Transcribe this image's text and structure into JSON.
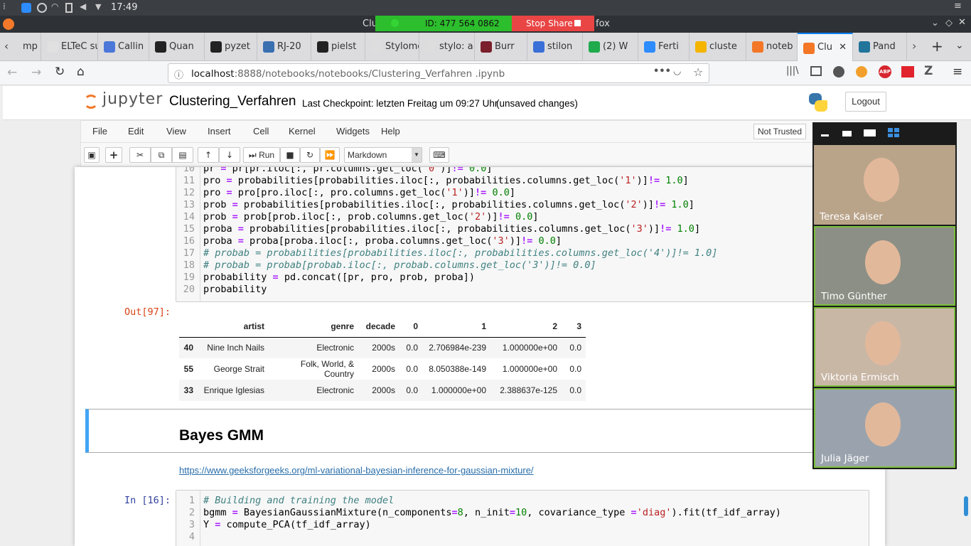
{
  "system": {
    "time": "17:49"
  },
  "share": {
    "meeting_id": "ID: 477 564 0862",
    "stop_label": "Stop Share",
    "title_left": "Clu",
    "title_right": "fox"
  },
  "tabs": [
    {
      "label": "mp",
      "color": "#777"
    },
    {
      "label": "ELTeC su",
      "color": "#e0e0e0"
    },
    {
      "label": "Callin",
      "color": "#4a77d8"
    },
    {
      "label": "Quan",
      "color": "#222"
    },
    {
      "label": "pyzet",
      "color": "#222"
    },
    {
      "label": "RJ-20",
      "color": "#3a6fb0"
    },
    {
      "label": "pielst",
      "color": "#222"
    },
    {
      "label": "Stylomet",
      "color": "#ddd"
    },
    {
      "label": "stylo: a p",
      "color": "#ddd"
    },
    {
      "label": "Burr",
      "color": "#7a1f2b"
    },
    {
      "label": "stilon",
      "color": "#3a6fd8"
    },
    {
      "label": "(2) W",
      "color": "#1faa4b"
    },
    {
      "label": "Ferti",
      "color": "#2d8cff"
    },
    {
      "label": "cluste",
      "color": "#f4b400"
    },
    {
      "label": "noteb",
      "color": "#f37726"
    },
    {
      "label": "Clu",
      "color": "#f37726"
    },
    {
      "label": "Pand",
      "color": "#21759b"
    }
  ],
  "url": {
    "host": "localhost",
    "rest": ":8888/notebooks/notebooks/Clustering_Verfahren .ipynb"
  },
  "jupyter": {
    "logo_text": "jupyter",
    "notebook_name": "Clustering_Verfahren",
    "checkpoint": "Last Checkpoint: letzten Freitag um 09:27 Uhr",
    "unsaved": "(unsaved changes)",
    "logout": "Logout",
    "not_trusted": "Not Trusted",
    "menu": [
      "File",
      "Edit",
      "View",
      "Insert",
      "Cell",
      "Kernel",
      "Widgets",
      "Help"
    ],
    "run_label": "Run",
    "cell_type": "Markdown"
  },
  "cell1": {
    "line_numbers": [
      "10",
      "11",
      "12",
      "13",
      "14",
      "15",
      "16",
      "17",
      "18",
      "19",
      "20"
    ],
    "out_prompt": "Out[97]:"
  },
  "dataframe": {
    "columns": [
      "",
      "artist",
      "genre",
      "decade",
      "0",
      "1",
      "2",
      "3"
    ],
    "rows": [
      [
        "40",
        "Nine Inch Nails",
        "Electronic",
        "2000s",
        "0.0",
        "2.706984e-239",
        "1.000000e+00",
        "0.0"
      ],
      [
        "55",
        "George Strait",
        "Folk, World, & Country",
        "2000s",
        "0.0",
        "8.050388e-149",
        "1.000000e+00",
        "0.0"
      ],
      [
        "33",
        "Enrique Iglesias",
        "Electronic",
        "2000s",
        "0.0",
        "1.000000e+00",
        "2.388637e-125",
        "0.0"
      ]
    ]
  },
  "markdown": {
    "heading": "Bayes GMM",
    "link": "https://www.geeksforgeeks.org/ml-variational-bayesian-inference-for-gaussian-mixture/"
  },
  "cell2": {
    "in_prompt": "In [16]:",
    "line_numbers": [
      "1",
      "2",
      "3",
      "4"
    ]
  },
  "participants": [
    {
      "name": "Teresa Kaiser",
      "bg": "#b9a48a"
    },
    {
      "name": "Timo Günther",
      "bg": "#8c8f85"
    },
    {
      "name": "Viktoria Ermisch",
      "bg": "#c9b7a6"
    },
    {
      "name": "Julia Jäger",
      "bg": "#9aa3ad"
    }
  ]
}
